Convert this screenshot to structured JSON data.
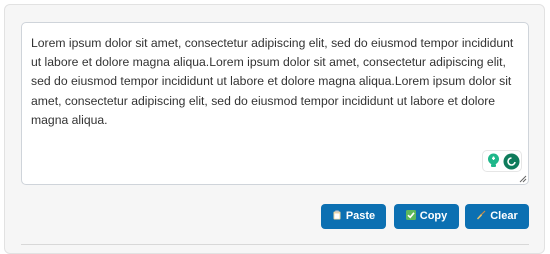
{
  "editor": {
    "text": "Lorem ipsum dolor sit amet, consectetur adipiscing elit, sed do eiusmod tempor incididunt ut labore et dolore magna aliqua.Lorem ipsum dolor sit amet, consectetur adipiscing elit, sed do eiusmod tempor incididunt ut labore et dolore magna aliqua.Lorem ipsum dolor sit amet, consectetur adipiscing elit, sed do eiusmod tempor incididunt ut labore et dolore magna aliqua."
  },
  "buttons": {
    "paste": {
      "label": "Paste",
      "icon": "clipboard-icon"
    },
    "copy": {
      "label": "Copy",
      "icon": "checkmark-icon"
    },
    "clear": {
      "label": "Clear",
      "icon": "broom-icon"
    }
  },
  "colors": {
    "button_bg": "#0c70b2",
    "button_text": "#ffffff",
    "panel_bg": "#f6f6f6",
    "grammar_accent": "#15c39a"
  }
}
